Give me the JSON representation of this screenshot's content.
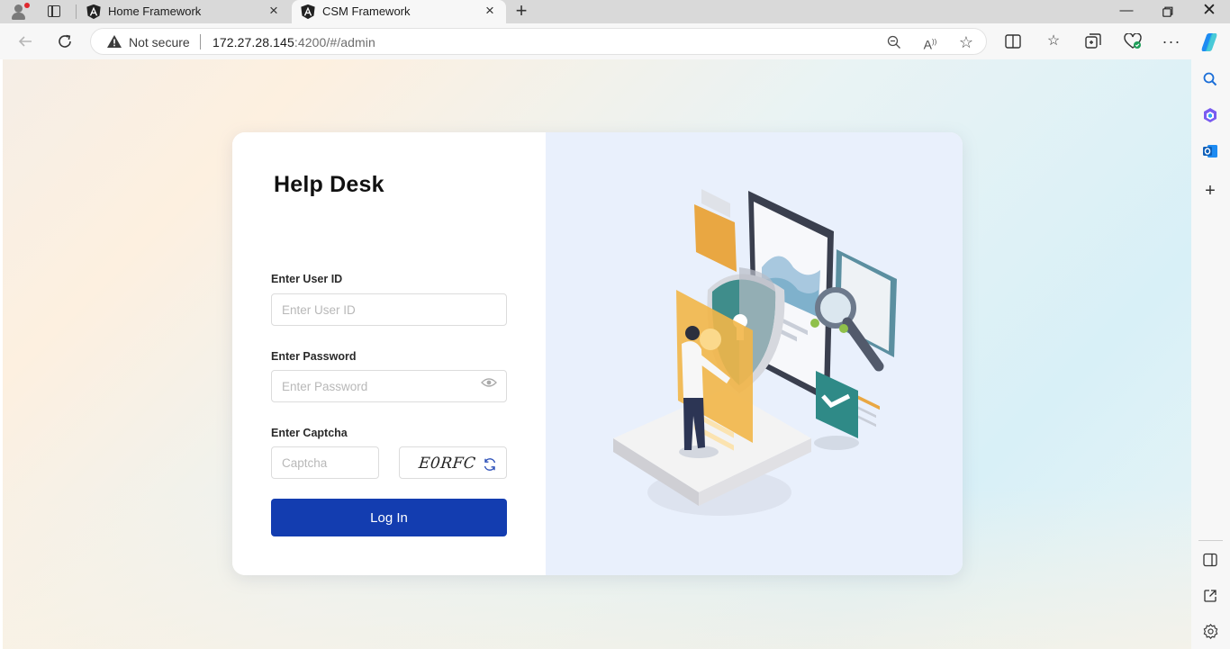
{
  "browser": {
    "tabs": [
      {
        "title": "Home Framework",
        "active": false
      },
      {
        "title": "CSM Framework",
        "active": true
      }
    ],
    "address": {
      "security_label": "Not secure",
      "url_host": "172.27.28.145",
      "url_rest": ":4200/#/admin"
    }
  },
  "login": {
    "title": "Help Desk",
    "user_id_label": "Enter User ID",
    "user_id_placeholder": "Enter User ID",
    "password_label": "Enter Password",
    "password_placeholder": "Enter Password",
    "captcha_label": "Enter Captcha",
    "captcha_placeholder": "Captcha",
    "captcha_text": "E0RFC",
    "login_button": "Log In"
  },
  "colors": {
    "primary": "#133db0",
    "illustration_panel": "#e9f0fc"
  }
}
